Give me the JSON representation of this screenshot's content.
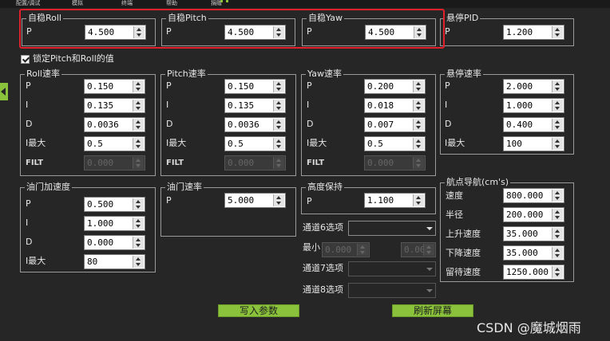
{
  "menu": [
    "配置/调试",
    "模拟",
    "终端",
    "帮助",
    "捐赠"
  ],
  "groups": {
    "stab_roll": {
      "title": "自稳Roll",
      "rows": [
        {
          "label": "P",
          "value": "4.500"
        }
      ]
    },
    "stab_pitch": {
      "title": "自稳Pitch",
      "rows": [
        {
          "label": "P",
          "value": "4.500"
        }
      ]
    },
    "stab_yaw": {
      "title": "自稳Yaw",
      "rows": [
        {
          "label": "P",
          "value": "4.500"
        }
      ]
    },
    "hover_pid": {
      "title": "悬停PID",
      "rows": [
        {
          "label": "P",
          "value": "1.200"
        }
      ]
    },
    "roll_rate": {
      "title": "Roll速率",
      "rows": [
        {
          "label": "P",
          "value": "0.150"
        },
        {
          "label": "I",
          "value": "0.135"
        },
        {
          "label": "D",
          "value": "0.0036"
        },
        {
          "label": "I最大",
          "value": "0.5"
        },
        {
          "label": "FILT",
          "value": "0.000"
        }
      ]
    },
    "pitch_rate": {
      "title": "Pitch速率",
      "rows": [
        {
          "label": "P",
          "value": "0.150"
        },
        {
          "label": "I",
          "value": "0.135"
        },
        {
          "label": "D",
          "value": "0.0036"
        },
        {
          "label": "I最大",
          "value": "0.5"
        },
        {
          "label": "FILT",
          "value": "0.000"
        }
      ]
    },
    "yaw_rate": {
      "title": "Yaw速率",
      "rows": [
        {
          "label": "P",
          "value": "0.200"
        },
        {
          "label": "I",
          "value": "0.018"
        },
        {
          "label": "D",
          "value": "0.007"
        },
        {
          "label": "I最大",
          "value": "0.5"
        },
        {
          "label": "FILT",
          "value": "0.000"
        }
      ]
    },
    "hover_rate": {
      "title": "悬停速率",
      "rows": [
        {
          "label": "P",
          "value": "2.000"
        },
        {
          "label": "I",
          "value": "1.000"
        },
        {
          "label": "D",
          "value": "0.400"
        },
        {
          "label": "I最大",
          "value": "100"
        }
      ]
    },
    "throttle_accel": {
      "title": "油门加速度",
      "rows": [
        {
          "label": "P",
          "value": "0.500"
        },
        {
          "label": "I",
          "value": "1.000"
        },
        {
          "label": "D",
          "value": "0.000"
        },
        {
          "label": "I最大",
          "value": "80"
        }
      ]
    },
    "throttle_rate": {
      "title": "油门速率",
      "rows": [
        {
          "label": "P",
          "value": "5.000"
        }
      ]
    },
    "alt_hold": {
      "title": "高度保持",
      "rows": [
        {
          "label": "P",
          "value": "1.100"
        }
      ]
    },
    "waypoint_nav": {
      "title": "航点导航(cm's)",
      "rows": [
        {
          "label": "速度",
          "value": "800.000"
        },
        {
          "label": "半径",
          "value": "200.000"
        },
        {
          "label": "上升速度",
          "value": "35.000"
        },
        {
          "label": "下降速度",
          "value": "35.000"
        },
        {
          "label": "留待速度",
          "value": "1250.000"
        }
      ]
    }
  },
  "lock_checkbox": {
    "label": "锁定Pitch和Roll的值",
    "checked": true
  },
  "ch6": {
    "label": "通道6选项",
    "min_label": "最小",
    "min_value": "0.000",
    "max_value": "0.000"
  },
  "ch7": {
    "label": "通道7选项"
  },
  "ch8": {
    "label": "通道8选项"
  },
  "buttons": {
    "write": "写入参数",
    "refresh": "刷新屏幕"
  },
  "watermark": "CSDN @魔城烟雨",
  "colors": {
    "background": "#262626",
    "accent_green": "#8ac33b",
    "highlight_red": "#e0202a",
    "border": "#9a9a9a"
  }
}
